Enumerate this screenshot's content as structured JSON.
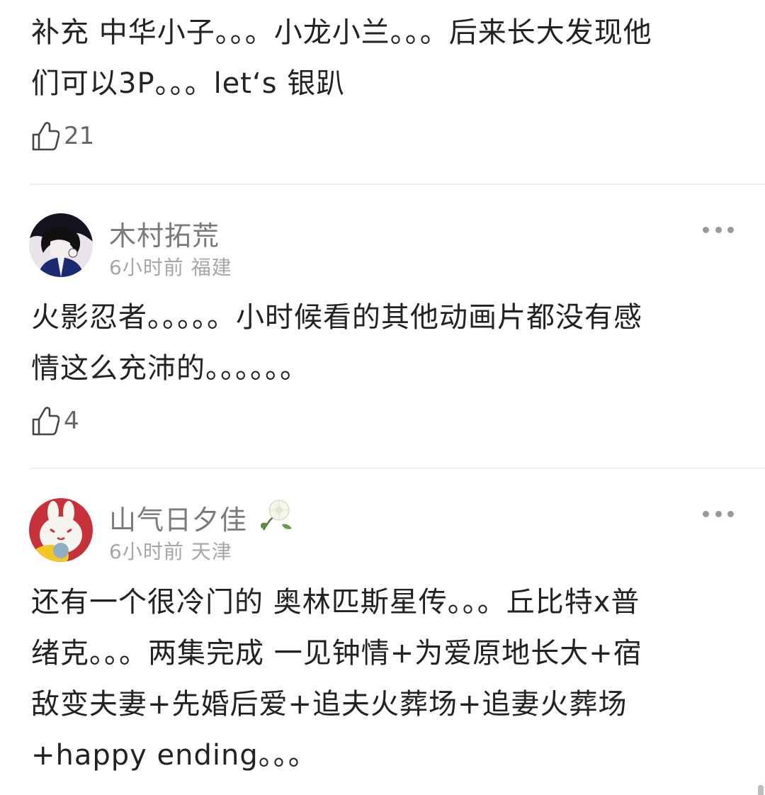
{
  "comments": [
    {
      "text": "补充 中华小子。。。小龙小兰。。。后来长大发现他\n们可以3P。。。let‘s 银趴",
      "likes": "21"
    },
    {
      "username": "木村拓荒",
      "time": "6小时前",
      "location": "福建",
      "text": "火影忍者。。。。。小时候看的其他动画片都没有感\n情这么充沛的。。。。。。",
      "likes": "4",
      "avatar_icon": "anime-boy-avatar"
    },
    {
      "username": "山气日夕佳",
      "time": "6小时前",
      "location": "天津",
      "text": "还有一个很冷门的 奥林匹斯星传。。。丘比特x普\n绪克。。。两集完成 一见钟情+为爱原地长大+宿\n敌变夫妻+先婚后爱+追夫火葬场+追妻火葬场\n+happy ending。。。",
      "avatar_icon": "rabbit-avatar",
      "badge_icon": "flower-badge-icon"
    }
  ],
  "colors": {
    "text": "#222222",
    "username": "#7a7a7a",
    "meta": "#a6a6a6",
    "divider": "#eeeeee"
  }
}
